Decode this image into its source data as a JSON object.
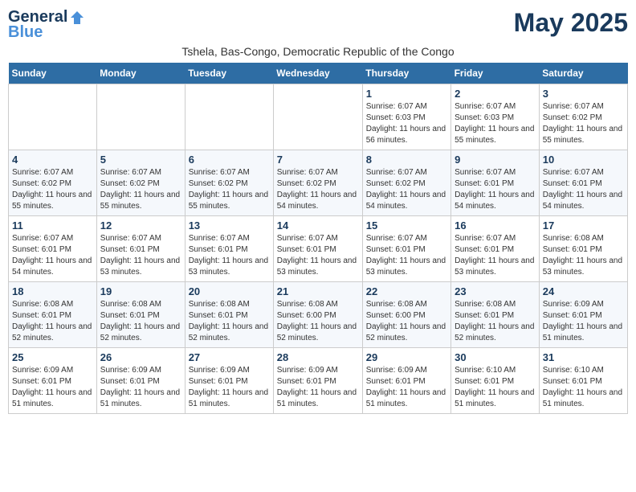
{
  "logo": {
    "general": "General",
    "blue": "Blue"
  },
  "title": {
    "month_year": "May 2025",
    "location": "Tshela, Bas-Congo, Democratic Republic of the Congo"
  },
  "weekdays": [
    "Sunday",
    "Monday",
    "Tuesday",
    "Wednesday",
    "Thursday",
    "Friday",
    "Saturday"
  ],
  "weeks": [
    [
      {
        "day": "",
        "info": ""
      },
      {
        "day": "",
        "info": ""
      },
      {
        "day": "",
        "info": ""
      },
      {
        "day": "",
        "info": ""
      },
      {
        "day": "1",
        "info": "Sunrise: 6:07 AM\nSunset: 6:03 PM\nDaylight: 11 hours and 56 minutes."
      },
      {
        "day": "2",
        "info": "Sunrise: 6:07 AM\nSunset: 6:03 PM\nDaylight: 11 hours and 55 minutes."
      },
      {
        "day": "3",
        "info": "Sunrise: 6:07 AM\nSunset: 6:02 PM\nDaylight: 11 hours and 55 minutes."
      }
    ],
    [
      {
        "day": "4",
        "info": "Sunrise: 6:07 AM\nSunset: 6:02 PM\nDaylight: 11 hours and 55 minutes."
      },
      {
        "day": "5",
        "info": "Sunrise: 6:07 AM\nSunset: 6:02 PM\nDaylight: 11 hours and 55 minutes."
      },
      {
        "day": "6",
        "info": "Sunrise: 6:07 AM\nSunset: 6:02 PM\nDaylight: 11 hours and 55 minutes."
      },
      {
        "day": "7",
        "info": "Sunrise: 6:07 AM\nSunset: 6:02 PM\nDaylight: 11 hours and 54 minutes."
      },
      {
        "day": "8",
        "info": "Sunrise: 6:07 AM\nSunset: 6:02 PM\nDaylight: 11 hours and 54 minutes."
      },
      {
        "day": "9",
        "info": "Sunrise: 6:07 AM\nSunset: 6:01 PM\nDaylight: 11 hours and 54 minutes."
      },
      {
        "day": "10",
        "info": "Sunrise: 6:07 AM\nSunset: 6:01 PM\nDaylight: 11 hours and 54 minutes."
      }
    ],
    [
      {
        "day": "11",
        "info": "Sunrise: 6:07 AM\nSunset: 6:01 PM\nDaylight: 11 hours and 54 minutes."
      },
      {
        "day": "12",
        "info": "Sunrise: 6:07 AM\nSunset: 6:01 PM\nDaylight: 11 hours and 53 minutes."
      },
      {
        "day": "13",
        "info": "Sunrise: 6:07 AM\nSunset: 6:01 PM\nDaylight: 11 hours and 53 minutes."
      },
      {
        "day": "14",
        "info": "Sunrise: 6:07 AM\nSunset: 6:01 PM\nDaylight: 11 hours and 53 minutes."
      },
      {
        "day": "15",
        "info": "Sunrise: 6:07 AM\nSunset: 6:01 PM\nDaylight: 11 hours and 53 minutes."
      },
      {
        "day": "16",
        "info": "Sunrise: 6:07 AM\nSunset: 6:01 PM\nDaylight: 11 hours and 53 minutes."
      },
      {
        "day": "17",
        "info": "Sunrise: 6:08 AM\nSunset: 6:01 PM\nDaylight: 11 hours and 53 minutes."
      }
    ],
    [
      {
        "day": "18",
        "info": "Sunrise: 6:08 AM\nSunset: 6:01 PM\nDaylight: 11 hours and 52 minutes."
      },
      {
        "day": "19",
        "info": "Sunrise: 6:08 AM\nSunset: 6:01 PM\nDaylight: 11 hours and 52 minutes."
      },
      {
        "day": "20",
        "info": "Sunrise: 6:08 AM\nSunset: 6:01 PM\nDaylight: 11 hours and 52 minutes."
      },
      {
        "day": "21",
        "info": "Sunrise: 6:08 AM\nSunset: 6:00 PM\nDaylight: 11 hours and 52 minutes."
      },
      {
        "day": "22",
        "info": "Sunrise: 6:08 AM\nSunset: 6:00 PM\nDaylight: 11 hours and 52 minutes."
      },
      {
        "day": "23",
        "info": "Sunrise: 6:08 AM\nSunset: 6:01 PM\nDaylight: 11 hours and 52 minutes."
      },
      {
        "day": "24",
        "info": "Sunrise: 6:09 AM\nSunset: 6:01 PM\nDaylight: 11 hours and 51 minutes."
      }
    ],
    [
      {
        "day": "25",
        "info": "Sunrise: 6:09 AM\nSunset: 6:01 PM\nDaylight: 11 hours and 51 minutes."
      },
      {
        "day": "26",
        "info": "Sunrise: 6:09 AM\nSunset: 6:01 PM\nDaylight: 11 hours and 51 minutes."
      },
      {
        "day": "27",
        "info": "Sunrise: 6:09 AM\nSunset: 6:01 PM\nDaylight: 11 hours and 51 minutes."
      },
      {
        "day": "28",
        "info": "Sunrise: 6:09 AM\nSunset: 6:01 PM\nDaylight: 11 hours and 51 minutes."
      },
      {
        "day": "29",
        "info": "Sunrise: 6:09 AM\nSunset: 6:01 PM\nDaylight: 11 hours and 51 minutes."
      },
      {
        "day": "30",
        "info": "Sunrise: 6:10 AM\nSunset: 6:01 PM\nDaylight: 11 hours and 51 minutes."
      },
      {
        "day": "31",
        "info": "Sunrise: 6:10 AM\nSunset: 6:01 PM\nDaylight: 11 hours and 51 minutes."
      }
    ]
  ]
}
